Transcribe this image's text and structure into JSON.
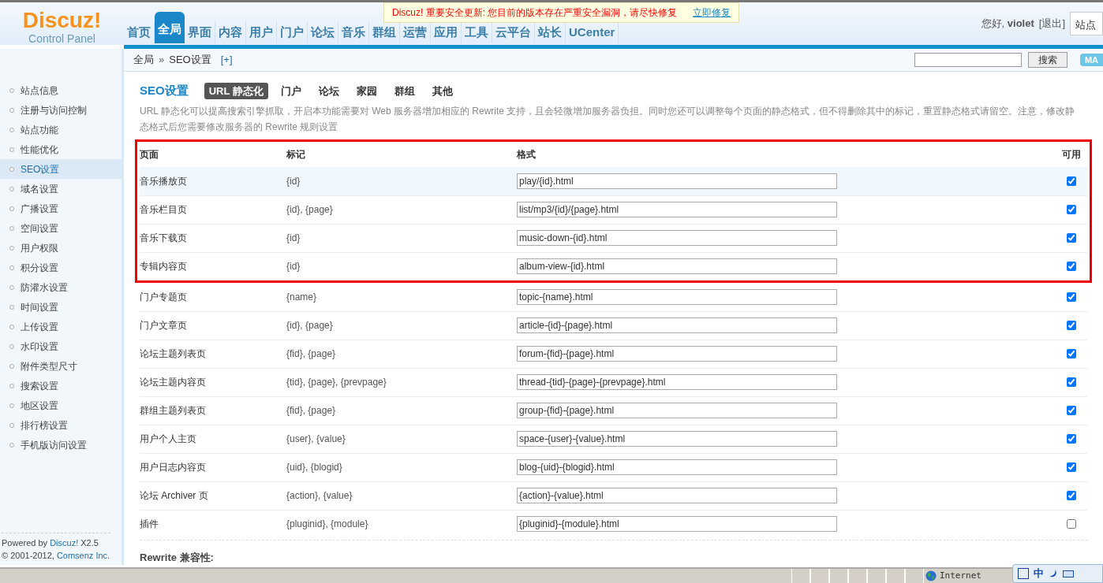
{
  "notice": {
    "text": "Discuz! 重要安全更新: 您目前的版本存在严重安全漏洞，请尽快修复",
    "link": "立即修复"
  },
  "logo": {
    "title": "Discuz!",
    "subtitle": "Control Panel"
  },
  "nav": [
    {
      "label": "首页",
      "selected": false
    },
    {
      "label": "全局",
      "selected": true
    },
    {
      "label": "界面",
      "selected": false
    },
    {
      "label": "内容",
      "selected": false
    },
    {
      "label": "用户",
      "selected": false
    },
    {
      "label": "门户",
      "selected": false
    },
    {
      "label": "论坛",
      "selected": false
    },
    {
      "label": "音乐",
      "selected": false
    },
    {
      "label": "群组",
      "selected": false
    },
    {
      "label": "运营",
      "selected": false
    },
    {
      "label": "应用",
      "selected": false
    },
    {
      "label": "工具",
      "selected": false
    },
    {
      "label": "云平台",
      "selected": false
    },
    {
      "label": "站长",
      "selected": false
    },
    {
      "label": "UCenter",
      "selected": false
    }
  ],
  "user": {
    "greeting": "您好,",
    "name": "violet",
    "logout": "[退出]",
    "site_home": "站点"
  },
  "breadcrumb": {
    "items": [
      "全局",
      "SEO设置"
    ],
    "separator": "»",
    "add": "[+]"
  },
  "search": {
    "button": "搜索",
    "map": "MA"
  },
  "sidebar": {
    "items": [
      {
        "label": "站点信息",
        "selected": false
      },
      {
        "label": "注册与访问控制",
        "selected": false
      },
      {
        "label": "站点功能",
        "selected": false
      },
      {
        "label": "性能优化",
        "selected": false
      },
      {
        "label": "SEO设置",
        "selected": true
      },
      {
        "label": "域名设置",
        "selected": false
      },
      {
        "label": "广播设置",
        "selected": false
      },
      {
        "label": "空间设置",
        "selected": false
      },
      {
        "label": "用户权限",
        "selected": false
      },
      {
        "label": "积分设置",
        "selected": false
      },
      {
        "label": "防灌水设置",
        "selected": false
      },
      {
        "label": "时间设置",
        "selected": false
      },
      {
        "label": "上传设置",
        "selected": false
      },
      {
        "label": "水印设置",
        "selected": false
      },
      {
        "label": "附件类型尺寸",
        "selected": false
      },
      {
        "label": "搜索设置",
        "selected": false
      },
      {
        "label": "地区设置",
        "selected": false
      },
      {
        "label": "排行榜设置",
        "selected": false
      },
      {
        "label": "手机版访问设置",
        "selected": false
      }
    ],
    "footer": {
      "powered": "Powered by",
      "product": "Discuz!",
      "version": "X2.5",
      "copyright": "© 2001-2012,",
      "company": "Comsenz Inc."
    }
  },
  "section": {
    "title": "SEO设置",
    "tabs": [
      {
        "label": "URL 静态化",
        "selected": true
      },
      {
        "label": "门户",
        "selected": false
      },
      {
        "label": "论坛",
        "selected": false
      },
      {
        "label": "家园",
        "selected": false
      },
      {
        "label": "群组",
        "selected": false
      },
      {
        "label": "其他",
        "selected": false
      }
    ],
    "description": "URL 静态化可以提高搜索引擎抓取，开启本功能需要对 Web 服务器增加相应的 Rewrite 支持，且会轻微增加服务器负担。同时您还可以调整每个页面的静态格式，但不得删除其中的标记，重置静态格式请留空。注意，修改静态格式后您需要修改服务器的 Rewrite 规则设置"
  },
  "table": {
    "columns": [
      "页面",
      "标记",
      "格式",
      "可用"
    ],
    "highlighted_rows": [
      {
        "page": "音乐播放页",
        "marks": "{id}",
        "format": "play/{id}.html",
        "enabled": true,
        "hovered": true
      },
      {
        "page": "音乐栏目页",
        "marks": "{id}, {page}",
        "format": "list/mp3/{id}/{page}.html",
        "enabled": true,
        "hovered": false
      },
      {
        "page": "音乐下载页",
        "marks": "{id}",
        "format": "music-down-{id}.html",
        "enabled": true,
        "hovered": false
      },
      {
        "page": "专辑内容页",
        "marks": "{id}",
        "format": "album-view-{id}.html",
        "enabled": true,
        "hovered": false
      }
    ],
    "rows": [
      {
        "page": "门户专题页",
        "marks": "{name}",
        "format": "topic-{name}.html",
        "enabled": true,
        "hovered": false
      },
      {
        "page": "门户文章页",
        "marks": "{id}, {page}",
        "format": "article-{id}-{page}.html",
        "enabled": true,
        "hovered": false
      },
      {
        "page": "论坛主题列表页",
        "marks": "{fid}, {page}",
        "format": "forum-{fid}-{page}.html",
        "enabled": true,
        "hovered": false
      },
      {
        "page": "论坛主题内容页",
        "marks": "{tid}, {page}, {prevpage}",
        "format": "thread-{tid}-{page}-{prevpage}.html",
        "enabled": true,
        "hovered": false
      },
      {
        "page": "群组主题列表页",
        "marks": "{fid}, {page}",
        "format": "group-{fid}-{page}.html",
        "enabled": true,
        "hovered": false
      },
      {
        "page": "用户个人主页",
        "marks": "{user}, {value}",
        "format": "space-{user}-{value}.html",
        "enabled": true,
        "hovered": false
      },
      {
        "page": "用户日志内容页",
        "marks": "{uid}, {blogid}",
        "format": "blog-{uid}-{blogid}.html",
        "enabled": true,
        "hovered": false
      },
      {
        "page": "论坛 Archiver 页",
        "marks": "{action}, {value}",
        "format": "{action}-{value}.html",
        "enabled": true,
        "hovered": false
      },
      {
        "page": "插件",
        "marks": "{pluginid}, {module}",
        "format": "{pluginid}-{module}.html",
        "enabled": false,
        "hovered": false
      }
    ]
  },
  "rewrite_heading": "Rewrite 兼容性:",
  "status_bar": {
    "zone": "Internet",
    "ime": "中"
  }
}
